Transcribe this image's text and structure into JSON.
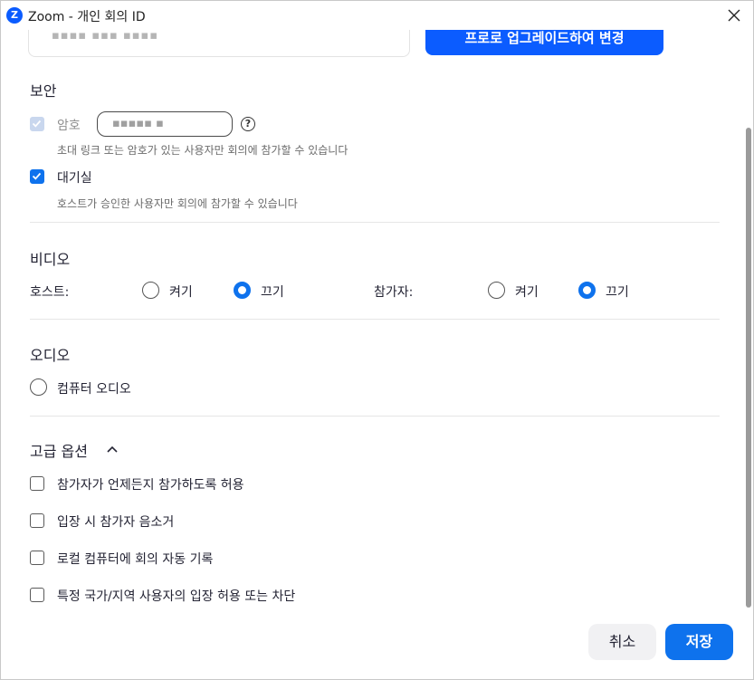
{
  "window": {
    "title": "Zoom - 개인 회의 ID",
    "logo_letter": "Z"
  },
  "meeting_id": {
    "masked_value": "▪▪▪▪ ▪▪▪ ▪▪▪▪"
  },
  "upgrade": {
    "label": "프로로 업그레이드하여 변경"
  },
  "security": {
    "title": "보안",
    "password": {
      "label": "암호",
      "value": "▪▪▪▪▪ ▪",
      "description": "초대 링크 또는 암호가 있는 사용자만 회의에 참가할 수 있습니다",
      "help": "?"
    },
    "waiting_room": {
      "label": "대기실",
      "description": "호스트가 승인한 사용자만 회의에 참가할 수 있습니다"
    }
  },
  "video": {
    "title": "비디오",
    "host_label": "호스트:",
    "participant_label": "참가자:",
    "on_label": "켜기",
    "off_label": "끄기"
  },
  "audio": {
    "title": "오디오",
    "computer_audio_label": "컴퓨터 오디오"
  },
  "advanced": {
    "title": "고급 옵션",
    "options": [
      "참가자가 언제든지 참가하도록 허용",
      "입장 시 참가자 음소거",
      "로컬 컴퓨터에 회의 자동 기록",
      "특정 국가/지역 사용자의 입장 허용 또는 차단"
    ]
  },
  "footer": {
    "cancel_label": "취소",
    "save_label": "저장"
  },
  "colors": {
    "accent": "#0e72ed",
    "upgrade_blue": "#0b5cff"
  }
}
